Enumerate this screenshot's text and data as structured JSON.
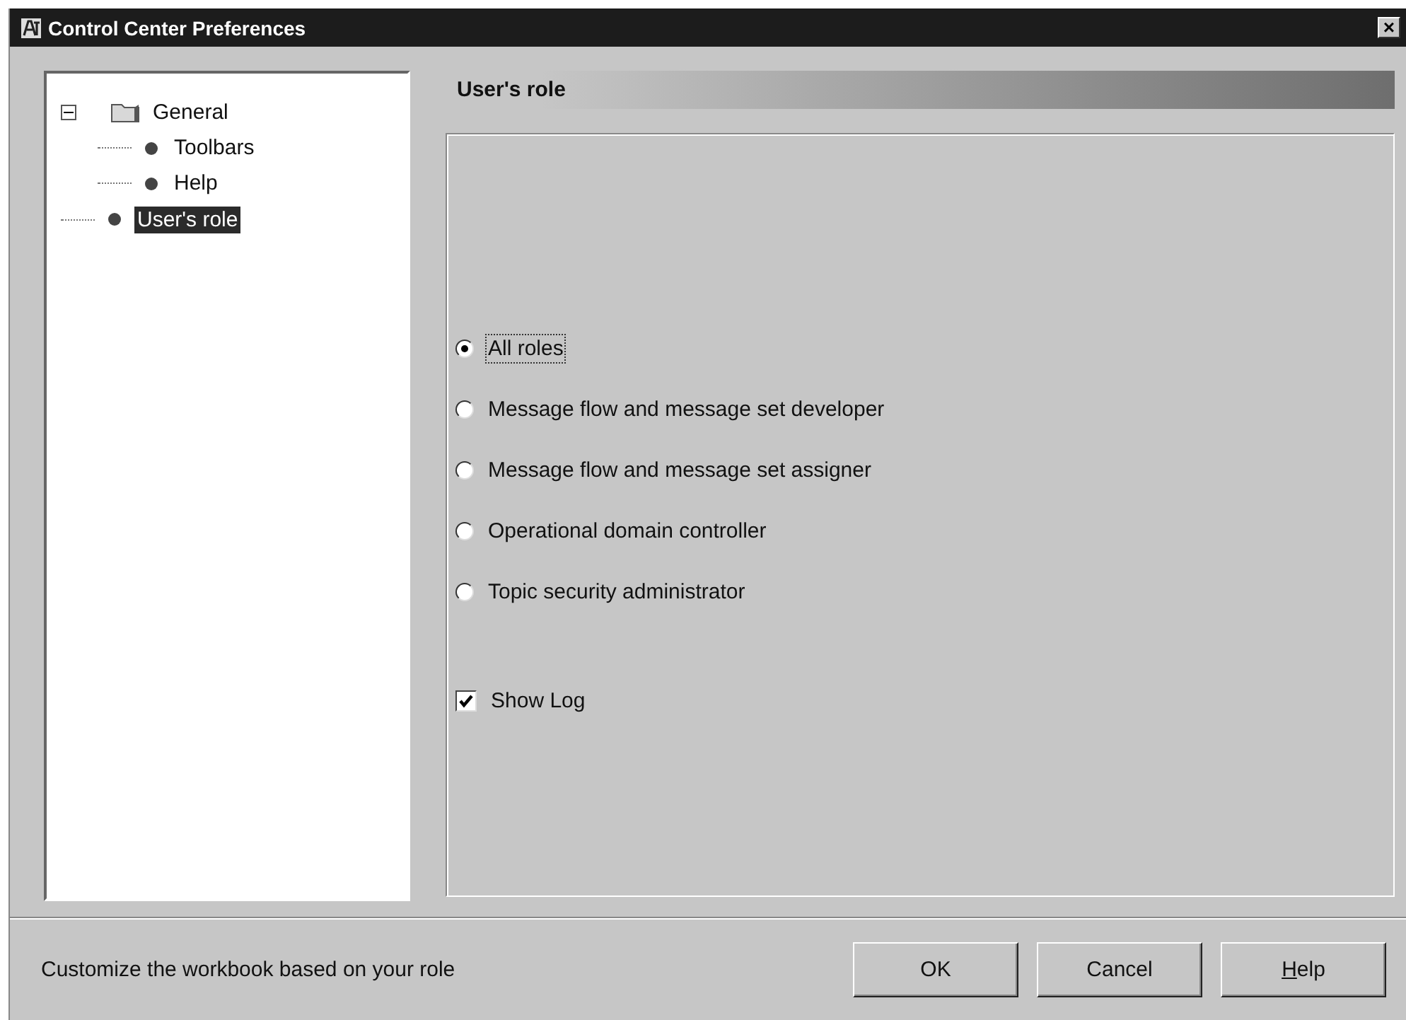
{
  "window": {
    "title": "Control Center Preferences",
    "close_label": "×"
  },
  "tree": [
    {
      "label": "General",
      "kind": "folder",
      "expanded": true,
      "selected": false,
      "children": [
        {
          "label": "Toolbars",
          "kind": "leaf",
          "selected": false
        },
        {
          "label": "Help",
          "kind": "leaf",
          "selected": false
        }
      ]
    },
    {
      "label": "User's role",
      "kind": "leaf",
      "selected": true
    }
  ],
  "panel": {
    "title": "User's role",
    "roles": [
      {
        "label": "All roles",
        "selected": true,
        "focused": true
      },
      {
        "label": "Message flow and message set developer",
        "selected": false,
        "focused": false
      },
      {
        "label": "Message flow and message set assigner",
        "selected": false,
        "focused": false
      },
      {
        "label": "Operational domain controller",
        "selected": false,
        "focused": false
      },
      {
        "label": "Topic security administrator",
        "selected": false,
        "focused": false
      }
    ],
    "show_log": {
      "label": "Show Log",
      "checked": true
    }
  },
  "status": "Customize the workbook based on your role",
  "buttons": [
    {
      "label": "OK",
      "mnemonic_underlined": false
    },
    {
      "label": "Cancel",
      "mnemonic_underlined": false
    },
    {
      "label": "Help",
      "mnemonic_underlined": true
    }
  ]
}
